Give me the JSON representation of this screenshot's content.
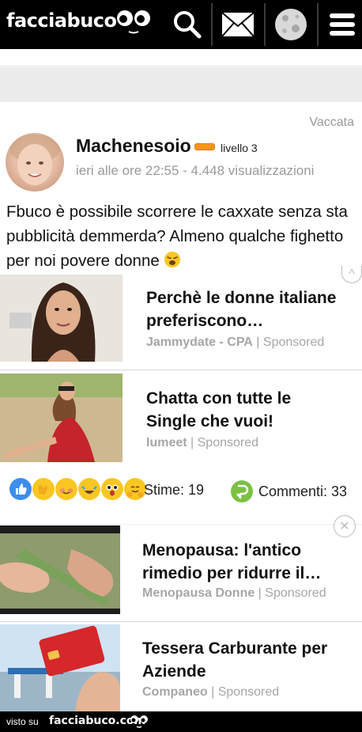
{
  "header": {
    "logo_text": "facciabuco",
    "icons": [
      "search-icon",
      "mail-icon",
      "moon-icon",
      "menu-icon"
    ]
  },
  "post": {
    "category": "Vaccata",
    "author": "Machenesoio",
    "level": "livello 3",
    "meta": "ieri alle ore 22:55 - 4.448 visualizzazioni",
    "text": "Fbuco è possibile scorrere le caxxate senza sta pubblicità demmerda? Almeno qualche fighetto per noi povere donne",
    "emoji": "weary-face"
  },
  "ads_top": [
    {
      "title": "Perchè le donne italiane preferiscono…",
      "source": "Jammydate - CPA",
      "sponsored": "Sponsored"
    },
    {
      "title": "Chatta con tutte le Single che vuoi!",
      "source": "Iumeet",
      "sponsored": "Sponsored"
    }
  ],
  "stats": {
    "likes_label": "Stime: 19",
    "comments_label": "Commenti: 33"
  },
  "ads_bottom": [
    {
      "title": "Menopausa: l'antico rimedio per ridurre il…",
      "source": "Menopausa Donne",
      "sponsored": "Sponsored"
    },
    {
      "title": "Tessera Carburante per Aziende",
      "source": "Companeo",
      "sponsored": "Sponsored"
    }
  ],
  "footer": {
    "left": "visto su",
    "logo": "facciabuco.com"
  },
  "colors": {
    "level": "#f7941d",
    "comment": "#7bc043",
    "topbar": "#000000"
  }
}
